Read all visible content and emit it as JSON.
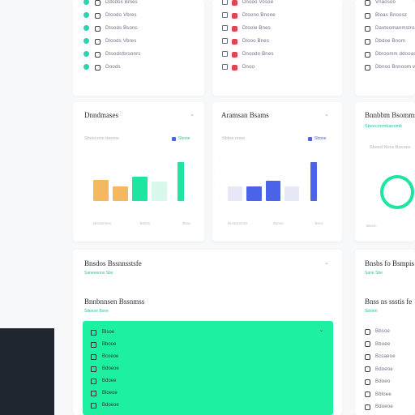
{
  "colors": {
    "accent_green": "#1df0a0",
    "teal": "#2bbfa0",
    "red": "#e0454f",
    "orange": "#f5b860",
    "blue": "#4a63e8",
    "dark": "#1f2630"
  },
  "top_lists": {
    "left": [
      "Ddodos Bmes",
      "Dloodo Vbres",
      "Dtoods Bsonc",
      "Dloods Vbres",
      "Dtoodstbrsonrs",
      "Ooods"
    ],
    "middle": [
      "Dnooo Vosoe",
      "Dtoono Bnone",
      "Dtoole Bnes",
      "Dlooo Bnes",
      "Dnoodo Bnes",
      "Dnoo"
    ],
    "right": [
      "Vnaosoo",
      "Bloas Bnoosz",
      "Daxtoomanmstroam",
      "Dbdoe Bnom",
      "Dbroomm ddooasd",
      "Dbnoo Bnnoom vnm"
    ]
  },
  "cards": {
    "chart1": {
      "title": "Dnndmases",
      "subtitle": "Sbeecone beome",
      "legend": "Sbone"
    },
    "chart2": {
      "title": "Aramsan Bsams",
      "subtitle": "Sbtoe nnoe",
      "legend": "Sbone"
    },
    "chart3": {
      "title": "Bnnbbm Bsomms",
      "subtitle": "Sbeed Nons Bonnes",
      "extra": "Sbeecnnmbaeomk"
    },
    "section1": {
      "title": "Bnsdos Bssnnsstsfe",
      "link": "Saneeeons Sbs"
    },
    "section2": {
      "title": "Bnnbnnsen Bssnmss",
      "link": "Sdeese Bsne"
    },
    "side1": {
      "title": "Bnsbs fo Bsmpis",
      "link": "Sane Sbe"
    },
    "side2": {
      "title": "Bnss ns ssstis fe",
      "link": "Sbsnm"
    }
  },
  "chart_data": [
    {
      "type": "bar",
      "categories": [
        "a",
        "b",
        "c",
        "d",
        "e"
      ],
      "values": [
        0.55,
        0.37,
        0.63,
        0.5,
        1.0
      ],
      "colors": [
        "#f5b860",
        "#f5b860",
        "#1de6a0",
        "#d8f8ec",
        "#1de6a0"
      ],
      "xlabels": [
        "Bnsssnnes",
        "Bsnns",
        "Bsnc"
      ],
      "title": "Dnndmases"
    },
    {
      "type": "bar",
      "categories": [
        "a",
        "b",
        "c",
        "d",
        "e"
      ],
      "values": [
        0.38,
        0.38,
        0.52,
        0.38,
        1.0
      ],
      "colors": [
        "#e6e8f7",
        "#4a63e8",
        "#4a63e8",
        "#e6e8f7",
        "#4a63e8"
      ],
      "xlabels": [
        "Bnsssonnes",
        "Bsnns",
        "Bnnc"
      ],
      "title": "Aramsan Bsams"
    }
  ],
  "green_list": [
    "Blsoe",
    "Bbooe",
    "Bcoeoe",
    "Bdoeoe",
    "Bdoee",
    "Bloeoe",
    "Bdoeoe"
  ],
  "side_list": [
    "Bbsoe",
    "Bboee",
    "Bcsaeoe",
    "Bdoeoe",
    "Bdoeo",
    "Bbloee",
    "Bdoeoe"
  ]
}
